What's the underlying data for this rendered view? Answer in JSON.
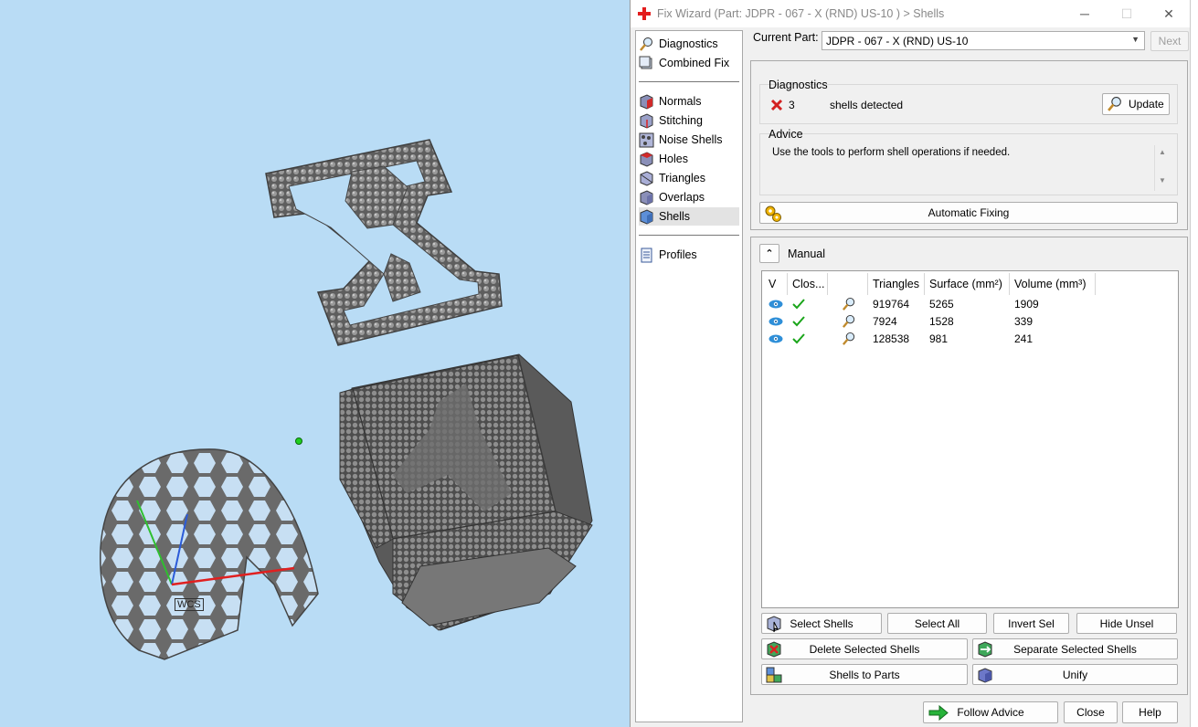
{
  "window": {
    "title": "Fix Wizard (Part: JDPR - 067 - X (RND) US-10 ) > Shells",
    "minimize": "─",
    "maximize": "☐",
    "close": "✕"
  },
  "viewport": {
    "wcs_label": "WCS"
  },
  "nav": {
    "items": [
      {
        "label": "Diagnostics",
        "icon": "magnifier-icon"
      },
      {
        "label": "Combined Fix",
        "icon": "combined-fix-icon"
      },
      {
        "label": "Normals",
        "icon": "normals-cube-icon"
      },
      {
        "label": "Stitching",
        "icon": "stitching-cube-icon"
      },
      {
        "label": "Noise Shells",
        "icon": "noise-shells-icon"
      },
      {
        "label": "Holes",
        "icon": "holes-cube-icon"
      },
      {
        "label": "Triangles",
        "icon": "triangles-cube-icon"
      },
      {
        "label": "Overlaps",
        "icon": "overlaps-cube-icon"
      },
      {
        "label": "Shells",
        "icon": "shells-cube-icon"
      },
      {
        "label": "Profiles",
        "icon": "profiles-doc-icon"
      }
    ],
    "active": "Shells"
  },
  "current_part": {
    "label": "Current Part:",
    "value": "JDPR - 067 - X (RND) US-10",
    "next_label": "Next"
  },
  "diagnostics": {
    "title": "Diagnostics",
    "count": "3",
    "message": "shells detected",
    "update_label": "Update"
  },
  "advice": {
    "title": "Advice",
    "text": "Use the tools to perform shell operations if needed."
  },
  "automatic_fixing_label": "Automatic Fixing",
  "manual": {
    "title": "Manual",
    "columns": [
      "V",
      "Clos...",
      "",
      "Triangles",
      "Surface (mm²)",
      "Volume (mm³)"
    ],
    "rows": [
      {
        "triangles": "919764",
        "surface": "5265",
        "volume": "1909"
      },
      {
        "triangles": "7924",
        "surface": "1528",
        "volume": "339"
      },
      {
        "triangles": "128538",
        "surface": "981",
        "volume": "241"
      }
    ]
  },
  "buttons": {
    "select_shells": "Select Shells",
    "select_all": "Select All",
    "invert_sel": "Invert Sel",
    "hide_unsel": "Hide Unsel",
    "delete_selected": "Delete Selected Shells",
    "separate_selected": "Separate Selected Shells",
    "shells_to_parts": "Shells to Parts",
    "unify": "Unify",
    "follow_advice": "Follow Advice",
    "close": "Close",
    "help": "Help"
  },
  "colors": {
    "accent_blue": "#2f8fd8",
    "check_green": "#1aa51a",
    "error_red": "#d32020",
    "viewport_bg": "#b9dcf5"
  }
}
